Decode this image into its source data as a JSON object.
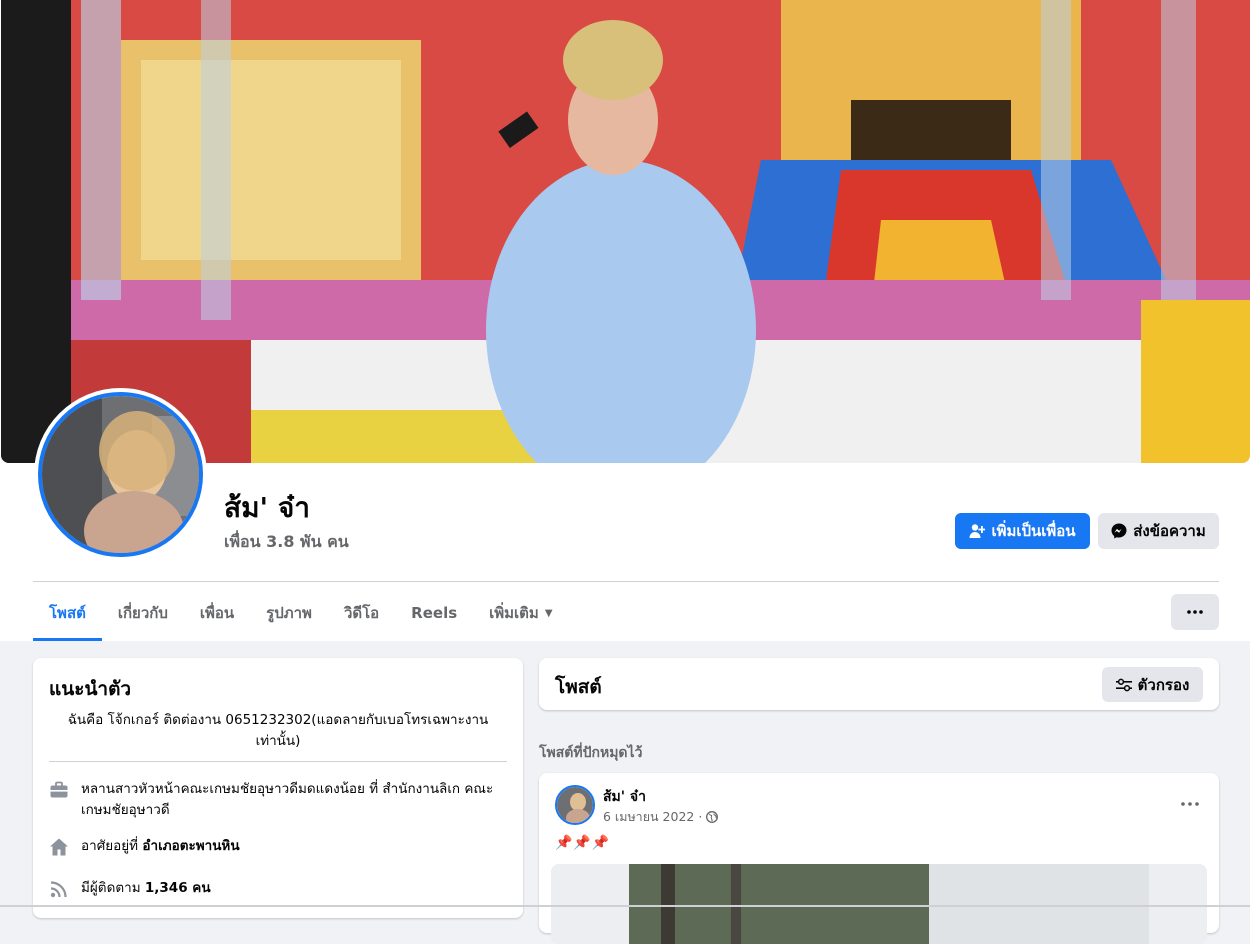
{
  "profile": {
    "name": "ส้ม' จ๋า",
    "friends_count": "เพื่อน 3.8 พัน คน"
  },
  "actions": {
    "add_friend": "เพิ่มเป็นเพื่อน",
    "message": "ส่งข้อความ"
  },
  "tabs": [
    {
      "label": "โพสต์"
    },
    {
      "label": "เกี่ยวกับ"
    },
    {
      "label": "เพื่อน"
    },
    {
      "label": "รูปภาพ"
    },
    {
      "label": "วิดีโอ"
    },
    {
      "label": "Reels"
    },
    {
      "label": "เพิ่มเติม"
    }
  ],
  "intro": {
    "title": "แนะนำตัว",
    "bio": "ฉันคือ โจ้กเกอร์ ติดต่องาน 0651232302(แอดลายกับเบอโทรเฉพาะงาน เท่านั้น)",
    "work": "หลานสาวหัวหน้าคณะเกษมชัยอุษาวดีมดแดงน้อย ที่ สำนักงานลิเก คณะเกษมชัยอุษาวดี",
    "lives_prefix": "อาศัยอยู่ที่ ",
    "lives_place": "อำเภอตะพานหิน",
    "followers_prefix": "มีผู้ติดตาม ",
    "followers_count": "1,346 คน"
  },
  "posts": {
    "title": "โพสต์",
    "filter": "ตัวกรอง",
    "pinned_label": "โพสต์ที่ปักหมุดไว้",
    "pinned_post": {
      "author": "ส้ม' จ๋า",
      "date": "6 เมษายน 2022 ·",
      "content": "📌📌📌"
    }
  },
  "colors": {
    "accent": "#1877f2",
    "page_bg": "#f0f2f5",
    "secondary_btn": "#e4e6eb",
    "muted_text": "#65676b"
  }
}
